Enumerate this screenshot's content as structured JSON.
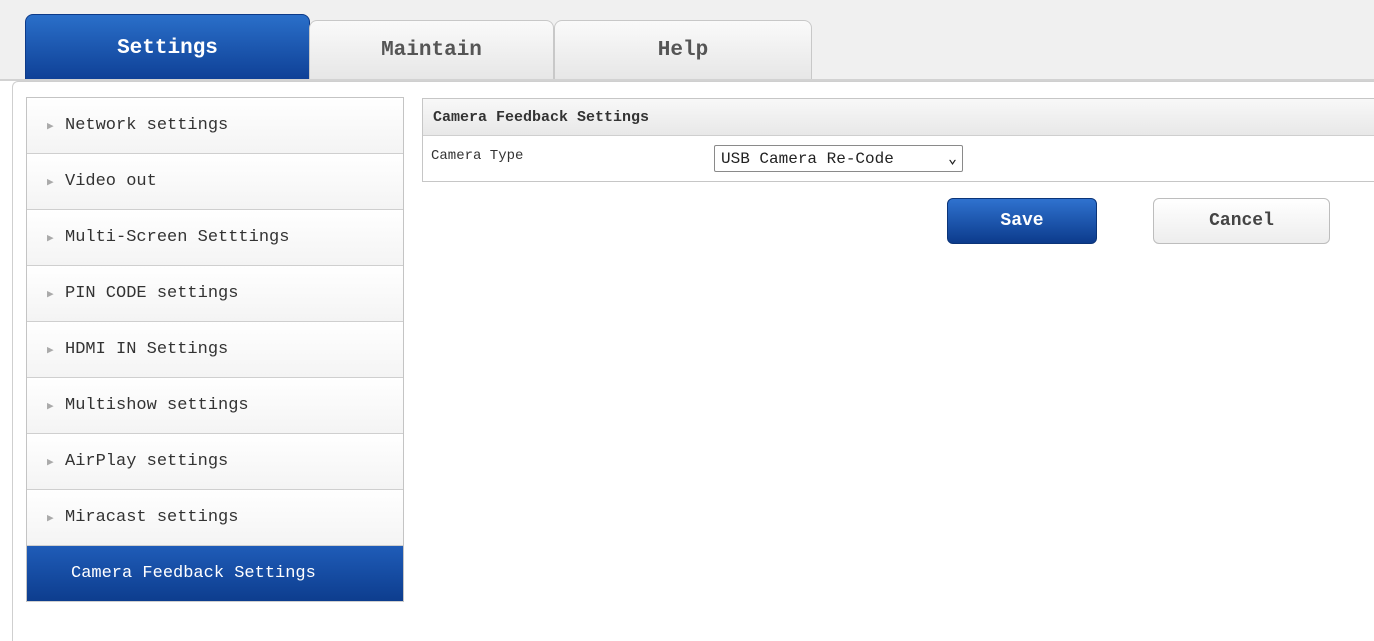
{
  "tabs": [
    {
      "label": "Settings",
      "active": true
    },
    {
      "label": "Maintain",
      "active": false
    },
    {
      "label": "Help",
      "active": false
    }
  ],
  "sidebar": {
    "items": [
      {
        "label": "Network settings"
      },
      {
        "label": "Video out"
      },
      {
        "label": "Multi-Screen Setttings"
      },
      {
        "label": "PIN CODE settings"
      },
      {
        "label": "HDMI IN Settings"
      },
      {
        "label": "Multishow settings"
      },
      {
        "label": "AirPlay settings"
      },
      {
        "label": "Miracast settings"
      },
      {
        "label": "Camera Feedback Settings",
        "active": true
      }
    ]
  },
  "panel": {
    "title": "Camera Feedback Settings",
    "camera_type_label": "Camera Type",
    "camera_type_value": "USB Camera Re-Code"
  },
  "buttons": {
    "save": "Save",
    "cancel": "Cancel"
  },
  "colors": {
    "accent_blue": "#0e3f95",
    "active_tab_top": "#2a6fc9"
  },
  "icons": {
    "menu_arrow": "triangle-right-icon",
    "select_arrow": "chevron-down-icon"
  }
}
